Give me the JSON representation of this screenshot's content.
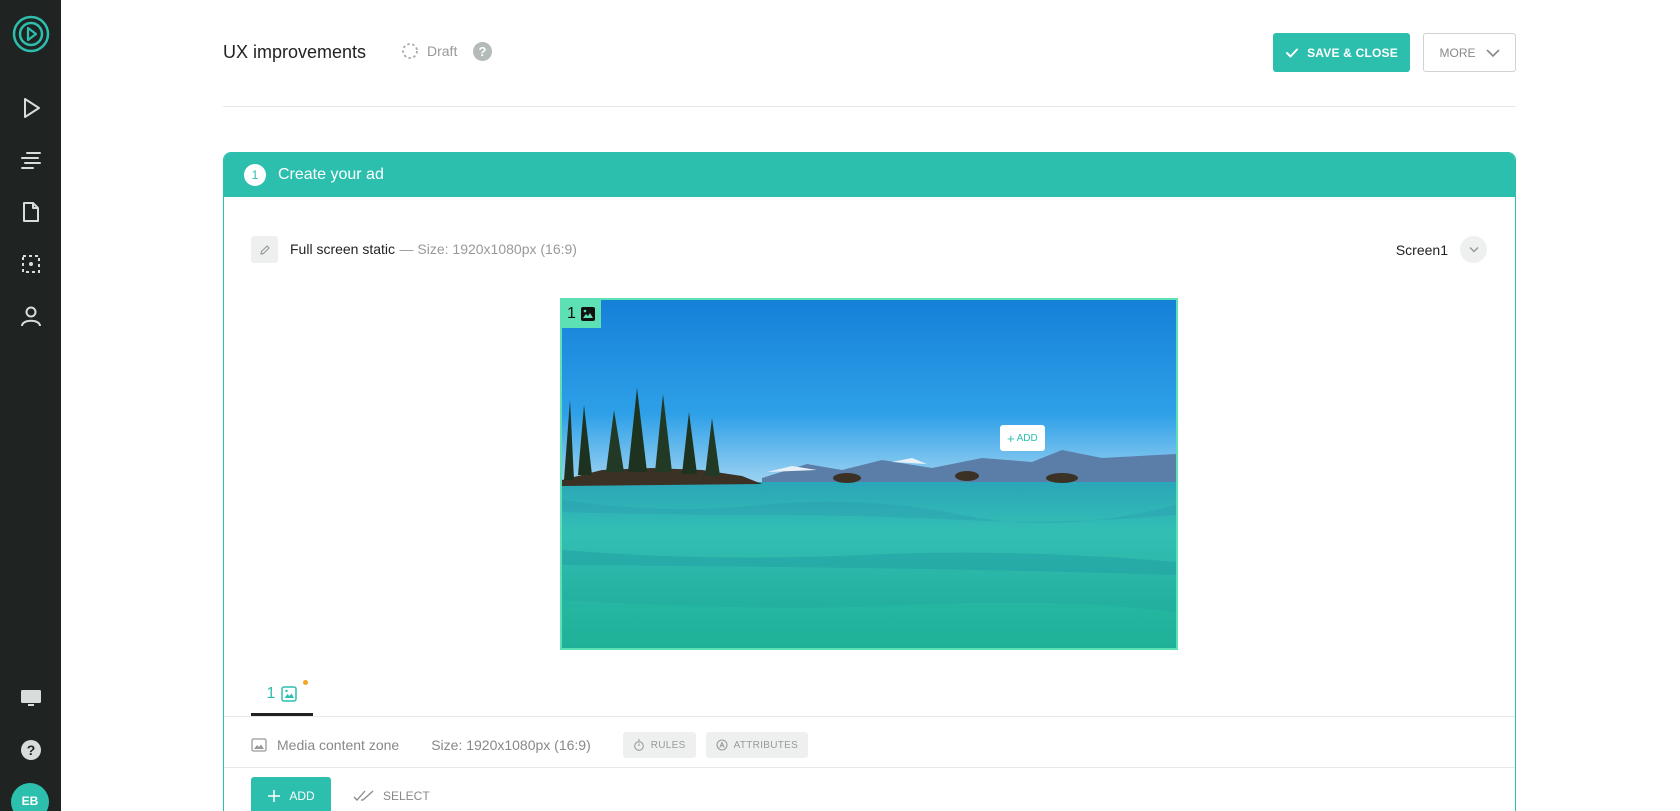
{
  "header": {
    "title": "UX improvements",
    "status": "Draft",
    "help": "?",
    "save_label": "SAVE & CLOSE",
    "more_label": "MORE"
  },
  "user": {
    "initials": "EB"
  },
  "card": {
    "step": "1",
    "title": "Create your ad",
    "layout_name": "Full screen static",
    "layout_size": "— Size: 1920x1080px (16:9)",
    "screen": "Screen1"
  },
  "preview": {
    "zone_number": "1",
    "add_label": "ADD"
  },
  "zone_tab": {
    "number": "1"
  },
  "zone_info": {
    "name": "Media content zone",
    "size": "Size: 1920x1080px (16:9)",
    "rules_label": "RULES",
    "attributes_label": "ATTRIBUTES"
  },
  "actions": {
    "add_label": "ADD",
    "select_label": "SELECT"
  },
  "colors": {
    "accent": "#2dbfae",
    "zone_highlight": "#5de0b4",
    "sidebar": "#1f2422",
    "badge_dot": "#f4a622"
  }
}
